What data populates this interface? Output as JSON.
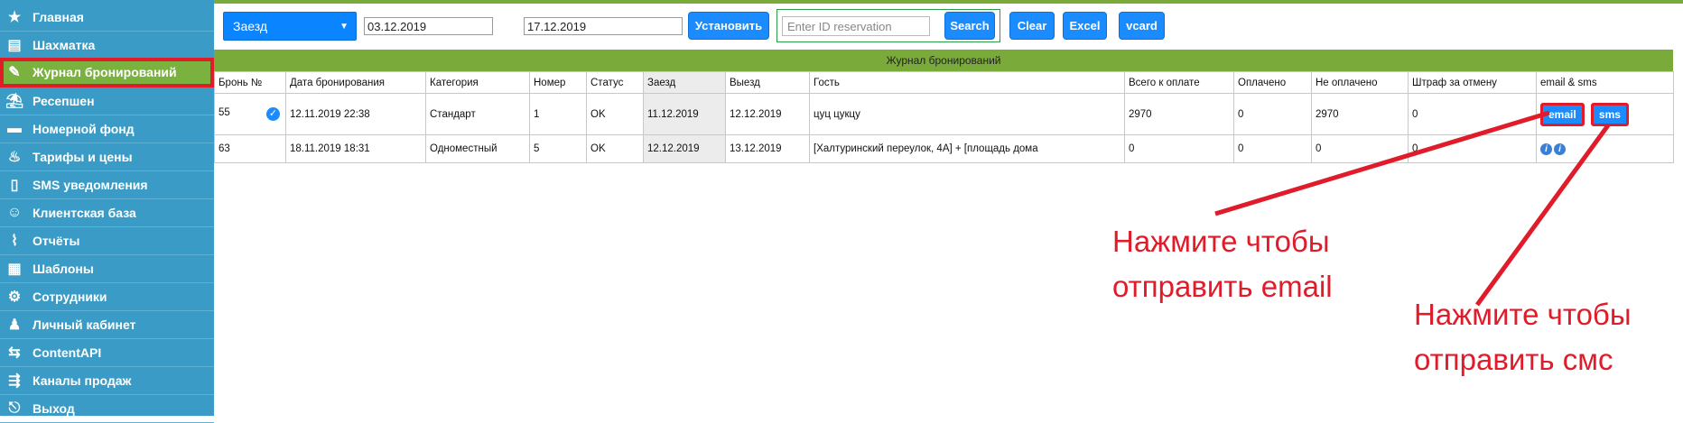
{
  "sidebar": {
    "items": [
      {
        "label": "Главная",
        "icon": "star-icon"
      },
      {
        "label": "Шахматка",
        "icon": "grid-icon"
      },
      {
        "label": "Журнал бронирований",
        "icon": "journal-icon"
      },
      {
        "label": "Ресепшен",
        "icon": "reception-icon"
      },
      {
        "label": "Номерной фонд",
        "icon": "bed-icon"
      },
      {
        "label": "Тарифы и цены",
        "icon": "price-icon"
      },
      {
        "label": "SMS уведомления",
        "icon": "phone-icon"
      },
      {
        "label": "Клиентская база",
        "icon": "client-icon"
      },
      {
        "label": "Отчёты",
        "icon": "chart-icon"
      },
      {
        "label": "Шаблоны",
        "icon": "template-icon"
      },
      {
        "label": "Сотрудники",
        "icon": "gear-icon"
      },
      {
        "label": "Личный кабинет",
        "icon": "user-icon"
      },
      {
        "label": "ContentAPI",
        "icon": "api-icon"
      },
      {
        "label": "Каналы продаж",
        "icon": "channel-icon"
      },
      {
        "label": "Выход",
        "icon": "exit-icon"
      }
    ],
    "active_index": 2
  },
  "toolbar": {
    "mode_select": "Заезд",
    "date_from": "03.12.2019",
    "date_to": "17.12.2019",
    "set_label": "Установить",
    "search_placeholder": "Enter ID reservation",
    "search_label": "Search",
    "clear_label": "Clear",
    "excel_label": "Excel",
    "vcard_label": "vcard"
  },
  "journal": {
    "title": "Журнал бронирований",
    "columns": [
      "Бронь №",
      "Дата бронирования",
      "Категория",
      "Номер",
      "Статус",
      "Заезд",
      "Выезд",
      "Гость",
      "Всего к оплате",
      "Оплачено",
      "Не оплачено",
      "Штраф за отмену",
      "email & sms"
    ],
    "rows": [
      {
        "id": "55",
        "booked": "12.11.2019 22:38",
        "category": "Стандарт",
        "room": "1",
        "status": "OK",
        "checkin": "11.12.2019",
        "checkout": "12.12.2019",
        "guest": "цуц цукцу",
        "total": "2970",
        "paid": "0",
        "unpaid": "2970",
        "penalty": "0",
        "email_btn": "email",
        "sms_btn": "sms"
      },
      {
        "id": "63",
        "booked": "18.11.2019 18:31",
        "category": "Одноместный",
        "room": "5",
        "status": "OK",
        "checkin": "12.12.2019",
        "checkout": "13.12.2019",
        "guest": "[Халтуринский переулок, 4А] + [площадь дома",
        "total": "0",
        "paid": "0",
        "unpaid": "0",
        "penalty": "0"
      }
    ]
  },
  "annotations": {
    "email_line1": "Нажмите чтобы",
    "email_line2": "отправить email",
    "sms_line1": "Нажмите чтобы",
    "sms_line2": "отправить смс"
  },
  "colors": {
    "sidebar": "#3a9cc6",
    "active": "#7ab13f",
    "accent": "#1a8cff",
    "annotation": "#e01b2a",
    "header_bar": "#7aaa3a"
  }
}
